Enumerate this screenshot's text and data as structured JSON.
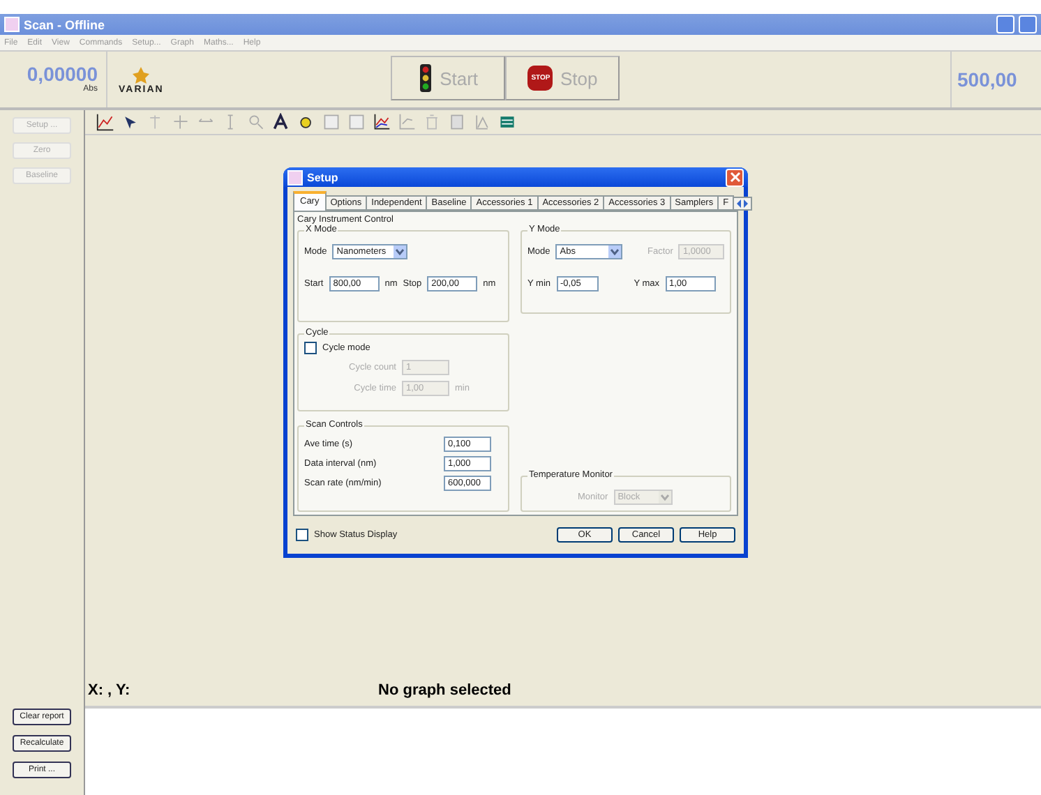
{
  "window": {
    "title": "Scan - Offline"
  },
  "menu": [
    "File",
    "Edit",
    "View",
    "Commands",
    "Setup...",
    "Graph",
    "Maths...",
    "Help"
  ],
  "header": {
    "reading": "0,00000",
    "unit": "Abs",
    "logo": "VARIAN",
    "start": "Start",
    "stop": "Stop",
    "stop_sign": "STOP",
    "right_reading": "500,00"
  },
  "sidebar": [
    {
      "label": "Setup ...",
      "disabled": true
    },
    {
      "label": "Zero",
      "disabled": true
    },
    {
      "label": "Baseline",
      "disabled": true
    }
  ],
  "status": {
    "coords": "X: , Y:",
    "message": "No graph selected"
  },
  "report_buttons": [
    {
      "label": "Clear report"
    },
    {
      "label": "Recalculate"
    },
    {
      "label": "Print ..."
    }
  ],
  "dialog": {
    "title": "Setup",
    "tabs": [
      {
        "label": "Cary",
        "selected": true
      },
      {
        "label": "Options",
        "selected": false
      },
      {
        "label": "Independent",
        "selected": false
      },
      {
        "label": "Baseline",
        "selected": false
      },
      {
        "label": "Accessories 1",
        "selected": false
      },
      {
        "label": "Accessories 2",
        "selected": false
      },
      {
        "label": "Accessories 3",
        "selected": false
      },
      {
        "label": "Samplers",
        "selected": false
      },
      {
        "label": "F",
        "selected": false
      }
    ],
    "section": "Cary Instrument Control",
    "x_mode": {
      "title": "X Mode",
      "mode_label": "Mode",
      "mode": "Nanometers",
      "start_label": "Start",
      "start": "800,00",
      "start_unit": "nm",
      "stop_label": "Stop",
      "stop": "200,00",
      "stop_unit": "nm"
    },
    "y_mode": {
      "title": "Y Mode",
      "mode_label": "Mode",
      "mode": "Abs",
      "factor_label": "Factor",
      "factor": "1,0000",
      "factor_disabled": true,
      "ymin_label": "Y min",
      "ymin": "-0,05",
      "ymax_label": "Y max",
      "ymax": "1,00"
    },
    "cycle": {
      "title": "Cycle",
      "checkbox_label": "Cycle mode",
      "checked": false,
      "count_label": "Cycle count",
      "count": "1",
      "time_label": "Cycle time",
      "time": "1,00",
      "time_unit": "min",
      "disabled": true
    },
    "scan_controls": {
      "title": "Scan Controls",
      "rows": [
        {
          "label": "Ave time (s)",
          "value": "0,100"
        },
        {
          "label": "Data interval (nm)",
          "value": "1,000"
        },
        {
          "label": "Scan rate (nm/min)",
          "value": "600,000"
        }
      ]
    },
    "temperature": {
      "title": "Temperature Monitor",
      "monitor_label": "Monitor",
      "monitor": "Block",
      "disabled": true
    },
    "show_status": {
      "label": "Show Status Display",
      "checked": false
    },
    "buttons": [
      "OK",
      "Cancel",
      "Help"
    ]
  }
}
